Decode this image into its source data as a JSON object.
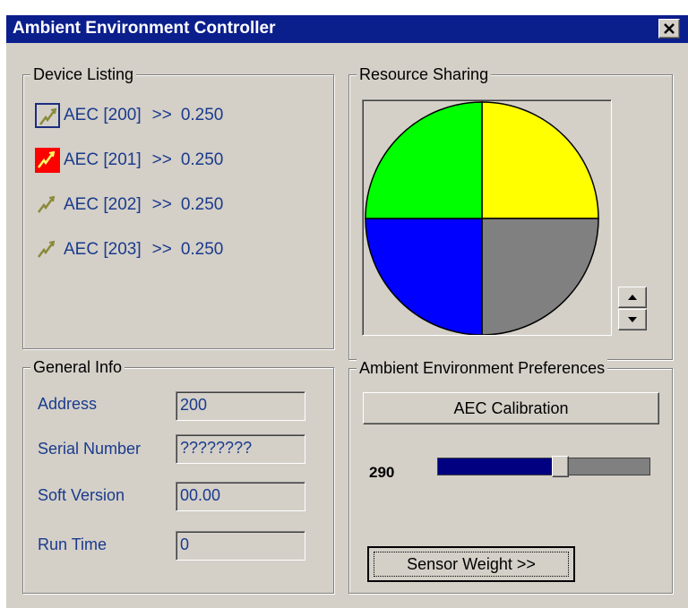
{
  "window": {
    "title": "Ambient Environment Controller",
    "close_label": "✕"
  },
  "device_listing": {
    "title": "Device Listing",
    "devices": [
      {
        "name": "AEC [200]",
        "arrow": ">>",
        "value": "0.250",
        "state": "selected"
      },
      {
        "name": "AEC [201]",
        "arrow": ">>",
        "value": "0.250",
        "state": "alert"
      },
      {
        "name": "AEC [202]",
        "arrow": ">>",
        "value": "0.250",
        "state": "normal"
      },
      {
        "name": "AEC [203]",
        "arrow": ">>",
        "value": "0.250",
        "state": "normal"
      }
    ]
  },
  "resource_sharing": {
    "title": "Resource Sharing",
    "spin_up_label": "▲",
    "spin_down_label": "▼"
  },
  "chart_data": {
    "type": "pie",
    "slices": [
      {
        "value": 25,
        "color": "#ffff00"
      },
      {
        "value": 25,
        "color": "#808080"
      },
      {
        "value": 25,
        "color": "#0000ff"
      },
      {
        "value": 25,
        "color": "#00ff00"
      }
    ]
  },
  "general_info": {
    "title": "General Info",
    "fields": [
      {
        "label": "Address",
        "value": "200"
      },
      {
        "label": "Serial Number",
        "value": "????????"
      },
      {
        "label": "Soft Version",
        "value": "00.00"
      },
      {
        "label": "Run Time",
        "value": "0"
      }
    ]
  },
  "preferences": {
    "title": "Ambient Environment Preferences",
    "calibration_button": "AEC Calibration",
    "slider_value": "290",
    "slider_fraction": 0.58,
    "sensor_weight_button": "Sensor Weight >>"
  },
  "colors": {
    "title_bar": "#0a1e8c",
    "window_bg": "#d4d0c8",
    "label_text": "#1a3a8c",
    "slider_fill": "#000080"
  }
}
